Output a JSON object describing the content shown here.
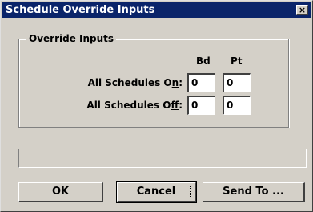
{
  "window": {
    "title": "Schedule Override Inputs",
    "close_glyph": "×"
  },
  "group": {
    "label": "Override Inputs"
  },
  "columns": {
    "bd": "Bd",
    "pt": "Pt"
  },
  "rows": {
    "on": {
      "label_pre": "All Schedules O",
      "label_accel": "n",
      "label_post": ":",
      "bd_value": "0",
      "pt_value": "0"
    },
    "off": {
      "label_pre": "All Schedules O",
      "label_accel": "f",
      "label_post": "f:",
      "bd_value": "0",
      "pt_value": "0"
    }
  },
  "status": {
    "text": ""
  },
  "buttons": {
    "ok": "OK",
    "cancel": "Cancel",
    "send_to": "Send To ..."
  },
  "colors": {
    "titlebar": "#0a246a",
    "face": "#d4d0c8"
  }
}
